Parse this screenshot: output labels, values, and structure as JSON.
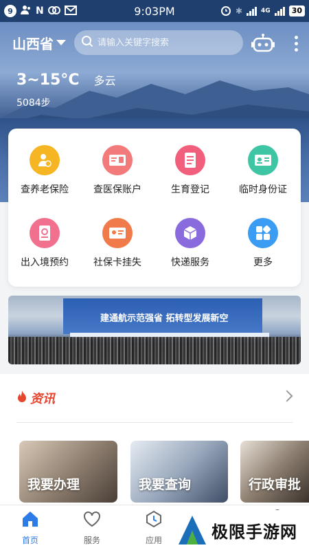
{
  "status_bar": {
    "badge": "9",
    "app_letter": "N",
    "time": "9:03PM",
    "network": "4G",
    "battery": "30"
  },
  "header": {
    "province": "山西省",
    "search_placeholder": "请输入关键字搜索"
  },
  "weather": {
    "temperature": "3~15°C",
    "condition": "多云",
    "steps": "5084步"
  },
  "services": [
    {
      "label": "查养老保险",
      "icon": "pension-icon",
      "color": "#f6b624"
    },
    {
      "label": "查医保账户",
      "icon": "medical-card-icon",
      "color": "#f27a7a"
    },
    {
      "label": "生育登记",
      "icon": "document-icon",
      "color": "#f25f7c"
    },
    {
      "label": "临时身份证",
      "icon": "id-card-icon",
      "color": "#3ec5a4"
    },
    {
      "label": "出入境预约",
      "icon": "passport-icon",
      "color": "#f1708e"
    },
    {
      "label": "社保卡挂失",
      "icon": "social-card-icon",
      "color": "#f07a4a"
    },
    {
      "label": "快递服务",
      "icon": "package-icon",
      "color": "#8a6bdd"
    },
    {
      "label": "更多",
      "icon": "more-grid-icon",
      "color": "#3a9cf2"
    }
  ],
  "banner": {
    "headline": "建通航示范强省   拓转型发展新空"
  },
  "news": {
    "title": "资讯",
    "tiles": [
      {
        "label": "我要办理"
      },
      {
        "label": "我要查询"
      },
      {
        "label": "行政审批"
      }
    ]
  },
  "bottom_nav": [
    {
      "label": "首页",
      "icon": "home-icon",
      "active": true
    },
    {
      "label": "服务",
      "icon": "heart-icon",
      "active": false
    },
    {
      "label": "应用",
      "icon": "app-icon",
      "active": false
    }
  ],
  "watermark": "极限手游网",
  "colors": {
    "accent": "#2d7be6",
    "news_red": "#e8452f",
    "status_bar": "#1f3f6f"
  }
}
